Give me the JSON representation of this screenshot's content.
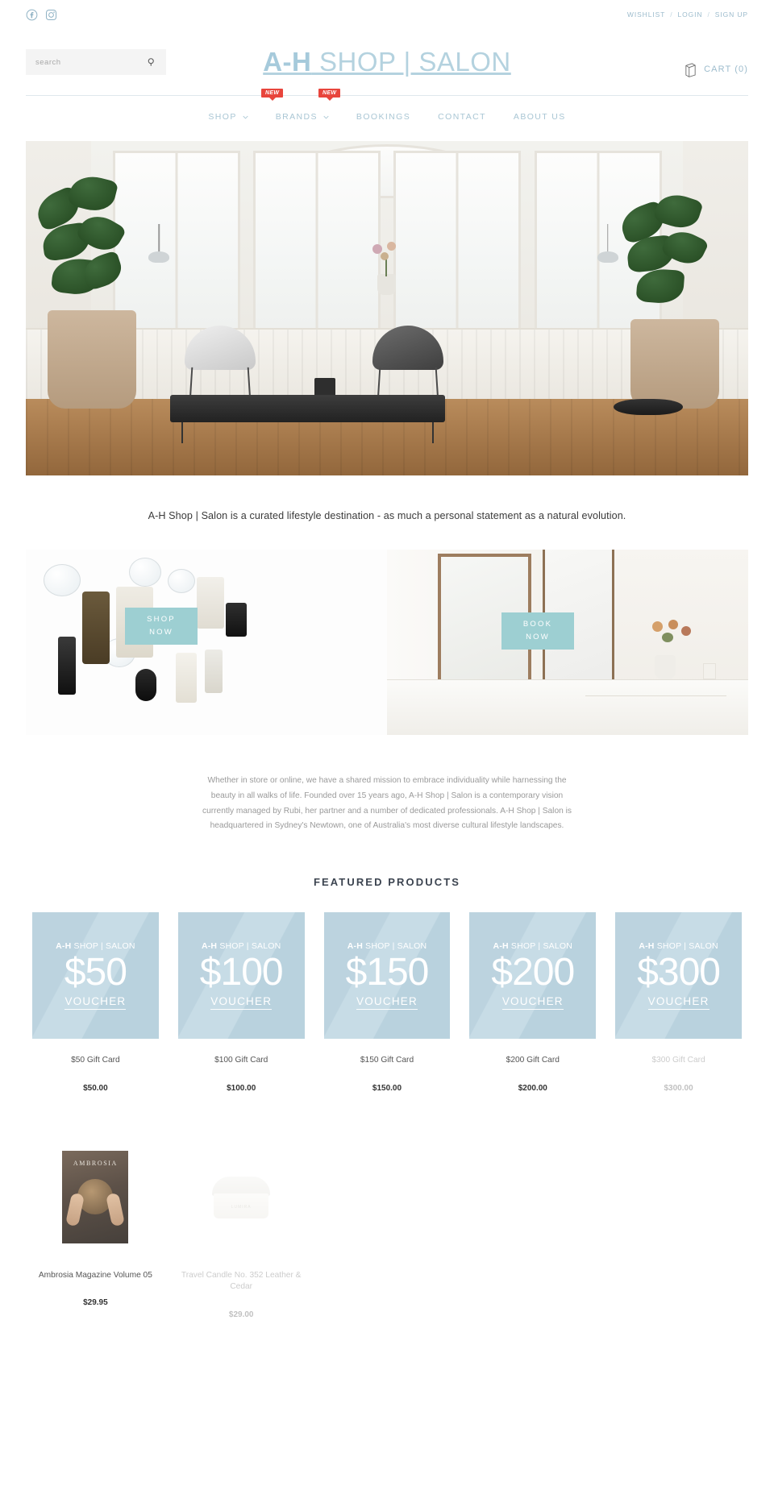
{
  "utility": {
    "social": [
      {
        "name": "facebook-icon",
        "label": "Facebook"
      },
      {
        "name": "instagram-icon",
        "label": "Instagram"
      }
    ],
    "links": [
      {
        "label": "WISHLIST"
      },
      {
        "label": "LOGIN"
      },
      {
        "label": "SIGN UP"
      }
    ],
    "separator": "/"
  },
  "header": {
    "search": {
      "placeholder": "search",
      "value": "",
      "icon": "search-icon"
    },
    "logo": {
      "bold_part": "A-H",
      "light_part": " SHOP | SALON",
      "full": "A-H SHOP | SALON",
      "color": "#b4d2df"
    },
    "cart": {
      "label": "CART (0)",
      "count": 0,
      "icon": "cart-bag-icon"
    }
  },
  "nav": {
    "badge_label": "NEW",
    "items": [
      {
        "label": "SHOP",
        "has_dropdown": true,
        "badge": "NEW"
      },
      {
        "label": "BRANDS",
        "has_dropdown": true,
        "badge": "NEW"
      },
      {
        "label": "BOOKINGS",
        "has_dropdown": false
      },
      {
        "label": "CONTACT",
        "has_dropdown": false
      },
      {
        "label": "ABOUT US",
        "has_dropdown": false
      }
    ]
  },
  "hero": {
    "alt": "Salon interior with arched windows, lounge chairs, bench and large fiddle-leaf fig plants"
  },
  "tagline": "A-H Shop | Salon is a curated lifestyle destination - as much a personal statement as a natural evolution.",
  "promos": [
    {
      "name": "shop-promo",
      "button_line1": "SHOP",
      "button_line2": "NOW",
      "alt": "Flat lay of skincare bottles and glassware"
    },
    {
      "name": "book-promo",
      "button_line1": "BOOK",
      "button_line2": "NOW",
      "alt": "Salon interior with mirrors, counter and flowers"
    }
  ],
  "promo_button_color": "#9dcfd2",
  "about": "Whether in store or online, we have a shared mission to embrace individuality while harnessing the beauty in all walks of life. Founded over 15 years ago, A-H Shop | Salon is a contemporary vision currently managed by Rubi, her partner and a number of dedicated professionals. A-H Shop | Salon is headquartered in Sydney's Newtown, one of Australia's most diverse cultural lifestyle landscapes.",
  "featured": {
    "title": "FEATURED PRODUCTS",
    "voucher_brand_bold": "A-H",
    "voucher_brand_light": " SHOP | SALON",
    "voucher_word": "VOUCHER",
    "card_color": "#bcd3df",
    "products": [
      {
        "amount": "$50",
        "name": "$50 Gift Card",
        "price": "$50.00",
        "opacity": "full"
      },
      {
        "amount": "$100",
        "name": "$100 Gift Card",
        "price": "$100.00",
        "opacity": "full"
      },
      {
        "amount": "$150",
        "name": "$150 Gift Card",
        "price": "$150.00",
        "opacity": "full"
      },
      {
        "amount": "$200",
        "name": "$200 Gift Card",
        "price": "$200.00",
        "opacity": "full"
      },
      {
        "amount": "$300",
        "name": "$300 Gift Card",
        "price": "$300.00",
        "opacity": "faded"
      }
    ],
    "products_row2": [
      {
        "name": "Ambrosia Magazine Volume 05",
        "price": "$29.95",
        "image": "magazine-cover",
        "image_text": "AMBROSIA",
        "opacity": "full"
      },
      {
        "name": "Travel Candle No. 352 Leather & Cedar",
        "price": "$29.00",
        "image": "candle-tin",
        "image_text": "LUMIRA",
        "opacity": "faded"
      }
    ]
  }
}
